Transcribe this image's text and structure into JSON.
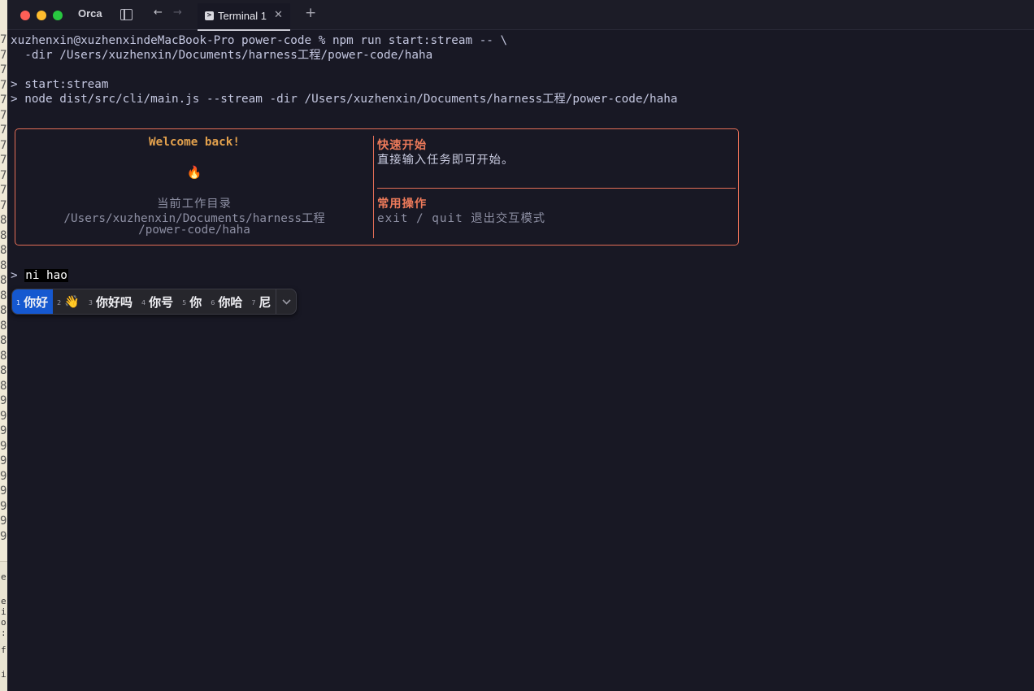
{
  "window": {
    "app_name": "Orca",
    "tab": {
      "label": "Terminal 1"
    }
  },
  "terminal": {
    "cmd_line1": "xuzhenxin@xuzhenxindeMacBook-Pro power-code % npm run start:stream -- \\",
    "cmd_line2": "  -dir /Users/xuzhenxin/Documents/harness工程/power-code/haha",
    "out_line1": "> start:stream",
    "out_line2": "> node dist/src/cli/main.js --stream -dir /Users/xuzhenxin/Documents/harness工程/power-code/haha",
    "welcome": {
      "title": "Welcome back!",
      "icon_glyph": "🔥",
      "cwd_label": "当前工作目录",
      "cwd_line1": "/Users/xuzhenxin/Documents/harness工程",
      "cwd_line2": "/power-code/haha",
      "quickstart_heading": "快速开始",
      "quickstart_text": "直接输入任务即可开始。",
      "common_heading": "常用操作",
      "common_text": "exit / quit 退出交互模式"
    },
    "prompt_symbol": ">",
    "input_text": "ni hao"
  },
  "ime": {
    "candidates": [
      {
        "num": "1",
        "text": "你好",
        "selected": true
      },
      {
        "num": "2",
        "text": "👋",
        "selected": false
      },
      {
        "num": "3",
        "text": "你好吗",
        "selected": false
      },
      {
        "num": "4",
        "text": "你号",
        "selected": false
      },
      {
        "num": "5",
        "text": "你",
        "selected": false
      },
      {
        "num": "6",
        "text": "你哈",
        "selected": false
      },
      {
        "num": "7",
        "text": "尼",
        "selected": false
      }
    ],
    "expand_icon": "chevron-down-icon"
  },
  "colors": {
    "terminal_bg": "#181824",
    "accent_border": "#e36e57",
    "welcome_title": "#e3a14d",
    "heading": "#ec7a5a",
    "ime_selected": "#1558d0"
  }
}
